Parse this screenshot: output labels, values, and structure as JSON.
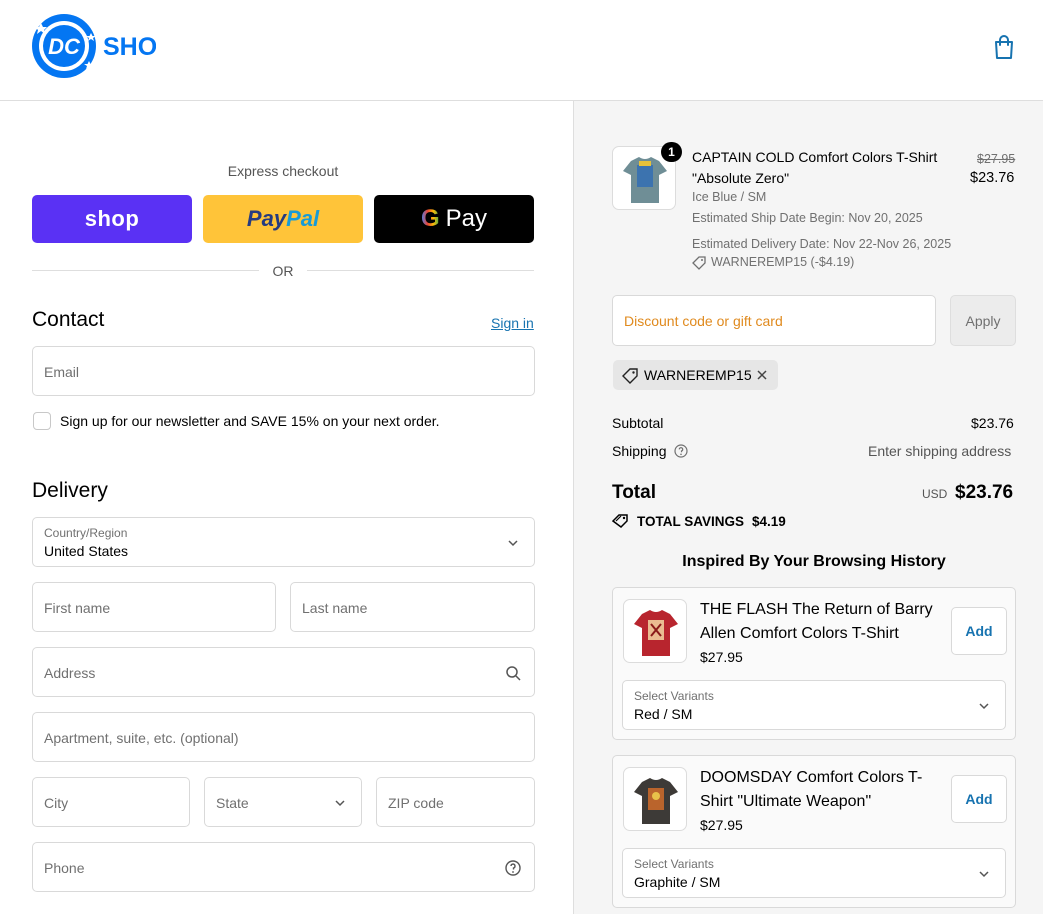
{
  "header": {
    "brand_text": "SHOP",
    "brand_initials": "DC",
    "cart_icon": "shopping-bag-icon"
  },
  "express": {
    "label": "Express checkout",
    "shop_pay_label": "shop",
    "paypal_label_1": "Pay",
    "paypal_label_2": "Pal",
    "gpay_g": "G",
    "gpay_label": "Pay",
    "or_label": "OR"
  },
  "contact": {
    "heading": "Contact",
    "sign_in_link": "Sign in",
    "email_placeholder": "Email",
    "newsletter_label": "Sign up for our newsletter and SAVE 15% on your next order."
  },
  "delivery": {
    "heading": "Delivery",
    "country_label": "Country/Region",
    "country_value": "United States",
    "first_name_placeholder": "First name",
    "last_name_placeholder": "Last name",
    "address_placeholder": "Address",
    "apartment_placeholder": "Apartment, suite, etc. (optional)",
    "city_placeholder": "City",
    "state_placeholder": "State",
    "zip_placeholder": "ZIP code",
    "phone_placeholder": "Phone"
  },
  "order": {
    "item": {
      "quantity": "1",
      "title_line1": "CAPTAIN COLD Comfort Colors T-Shirt",
      "title_line2": "\"Absolute Zero\"",
      "variant": "Ice Blue / SM",
      "original_price": "$27.95",
      "price": "$23.76",
      "ship_date": "Estimated Ship Date Begin: Nov 20, 2025",
      "delivery_date": "Estimated Delivery Date: Nov 22-Nov 26, 2025",
      "discount_tag": "WARNEREMP15 (-$4.19)"
    },
    "discount_placeholder": "Discount code or gift card",
    "apply_label": "Apply",
    "applied_code": "WARNEREMP15",
    "subtotal_label": "Subtotal",
    "subtotal_value": "$23.76",
    "shipping_label": "Shipping",
    "shipping_value": "Enter shipping address",
    "total_label": "Total",
    "total_currency": "USD",
    "total_value": "$23.76",
    "savings_label": "TOTAL SAVINGS",
    "savings_value": "$4.19"
  },
  "recommendations": {
    "heading": "Inspired By Your Browsing History",
    "items": [
      {
        "title": "THE FLASH The Return of Barry Allen Comfort Colors T-Shirt",
        "price": "$27.95",
        "add_label": "Add",
        "variant_label": "Select Variants",
        "variant_value": "Red / SM",
        "shirt_color": "#b8252e"
      },
      {
        "title": "DOOMSDAY Comfort Colors T-Shirt \"Ultimate Weapon\"",
        "price": "$27.95",
        "add_label": "Add",
        "variant_label": "Select Variants",
        "variant_value": "Graphite / SM",
        "shirt_color": "#3d3a37"
      }
    ]
  },
  "colors": {
    "shop_pay": "#5a31f4",
    "paypal": "#ffc439",
    "link": "#1773b0",
    "product_shirt": "#6f8e96"
  }
}
